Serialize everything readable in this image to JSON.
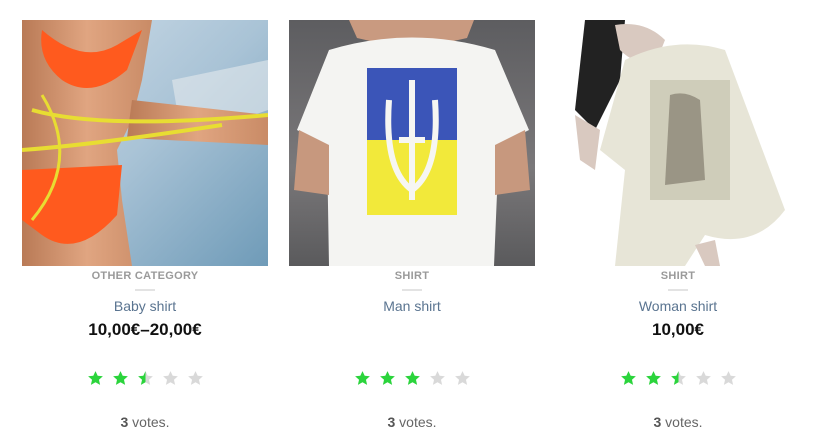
{
  "products": [
    {
      "category": "OTHER CATEGORY",
      "title": "Baby shirt",
      "price": "10,00€–20,00€",
      "rating": 2.5,
      "vote_count": "3",
      "votes_suffix": " votes."
    },
    {
      "category": "SHIRT",
      "title": "Man shirt",
      "price": "",
      "rating": 3,
      "vote_count": "3",
      "votes_suffix": " votes."
    },
    {
      "category": "SHIRT",
      "title": "Woman shirt",
      "price": "10,00€",
      "rating": 2.5,
      "vote_count": "3",
      "votes_suffix": " votes."
    }
  ],
  "colors": {
    "star_on": "#2bd43c",
    "star_off": "#d9d9d9",
    "link": "#5a7490"
  },
  "icons": {
    "star": "star-icon"
  }
}
